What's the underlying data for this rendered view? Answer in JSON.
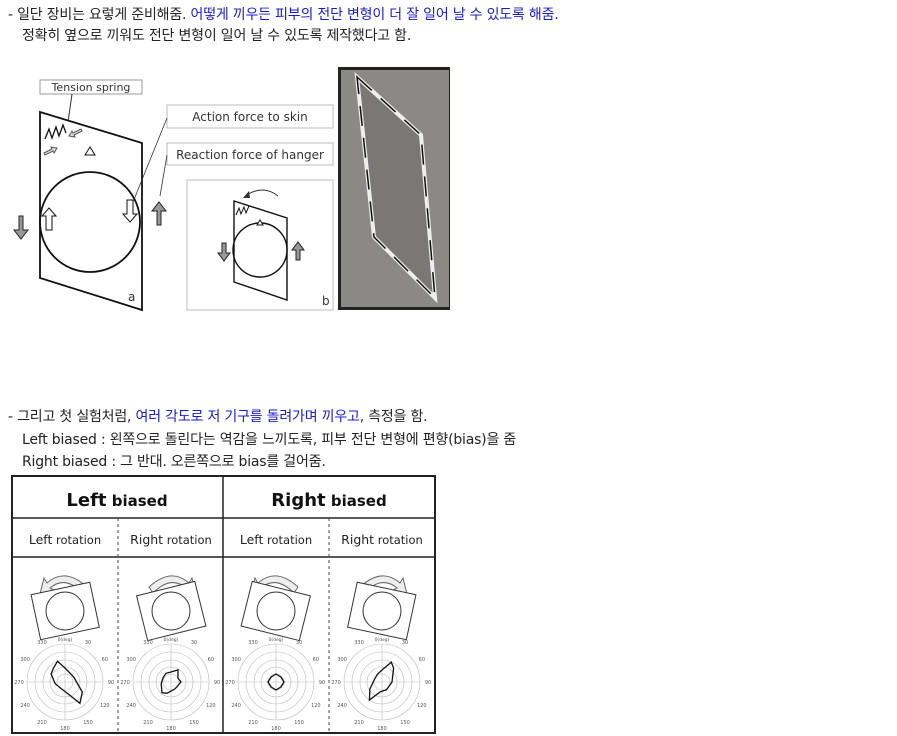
{
  "section1": {
    "line1_prefix": "- 일단 장비는 요렇게 준비해줌. ",
    "line1_highlight": "어떻게 끼우든 피부의 전단 변형이 더 잘 일어 날 수 있도록 해줌.",
    "line2": "정확히 옆으로 끼워도 전단 변형이 일어 날 수 있도록 제작했다고 함."
  },
  "figure1": {
    "labels": {
      "tension_spring": "Tension spring",
      "action_force": "Action force to skin",
      "reaction_force": "Reaction force of hanger",
      "panel_a": "a",
      "panel_b": "b"
    }
  },
  "section2": {
    "line1_prefix": "- 그리고 첫 실험처럼, ",
    "line1_highlight": "여러 각도로 저 기구를 돌려가며 끼우고",
    "line1_suffix": ", 측정을 함.",
    "line2": "Left biased : 왼쪽으로 돌린다는 역감을 느끼도록, 피부 전단 변형에 편향(bias)을 줌",
    "line3": "Right biased : 그 반대. 오른쪽으로 bias를 걸어줌."
  },
  "figure2": {
    "headers": [
      {
        "bold": "Left",
        "rest": " biased"
      },
      {
        "bold": "Right",
        "rest": " biased"
      }
    ],
    "subheaders": [
      {
        "bold": "Left",
        "rest": " rotation"
      },
      {
        "bold": "Right",
        "rest": " rotation"
      },
      {
        "bold": "Left",
        "rest": " rotation"
      },
      {
        "bold": "Right",
        "rest": " rotation"
      }
    ],
    "polar_zero_label": "0(deg)",
    "polar_angle_labels": [
      "30",
      "60",
      "90",
      "120",
      "150",
      "180",
      "210",
      "240",
      "270",
      "300",
      "330"
    ]
  }
}
